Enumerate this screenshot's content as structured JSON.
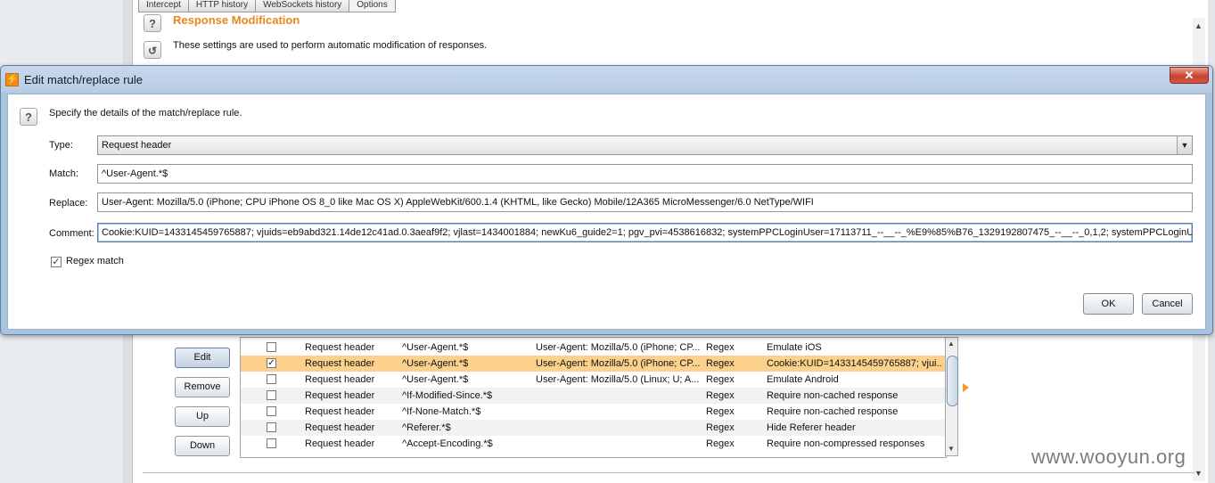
{
  "background": {
    "tabs": [
      "Intercept",
      "HTTP history",
      "WebSockets history",
      "Options"
    ],
    "active_tab": "Options",
    "section_title": "Response Modification",
    "section_desc": "These settings are used to perform automatic modification of responses.",
    "help_glyph": "?",
    "refresh_glyph": "↺"
  },
  "rules": {
    "buttons": {
      "edit": "Edit",
      "remove": "Remove",
      "up": "Up",
      "down": "Down"
    },
    "rows": [
      {
        "checked": false,
        "type": "Request header",
        "match": "^User-Agent.*$",
        "replace": "User-Agent: Mozilla/5.0 (iPhone; CP...",
        "kind": "Regex",
        "comment": "Emulate iOS"
      },
      {
        "checked": true,
        "type": "Request header",
        "match": "^User-Agent.*$",
        "replace": "User-Agent: Mozilla/5.0 (iPhone; CP...",
        "kind": "Regex",
        "comment": "Cookie:KUID=1433145459765887; vjui..."
      },
      {
        "checked": false,
        "type": "Request header",
        "match": "^User-Agent.*$",
        "replace": "User-Agent: Mozilla/5.0 (Linux; U; A...",
        "kind": "Regex",
        "comment": "Emulate Android"
      },
      {
        "checked": false,
        "type": "Request header",
        "match": "^If-Modified-Since.*$",
        "replace": "",
        "kind": "Regex",
        "comment": "Require non-cached response"
      },
      {
        "checked": false,
        "type": "Request header",
        "match": "^If-None-Match.*$",
        "replace": "",
        "kind": "Regex",
        "comment": "Require non-cached response"
      },
      {
        "checked": false,
        "type": "Request header",
        "match": "^Referer.*$",
        "replace": "",
        "kind": "Regex",
        "comment": "Hide Referer header"
      },
      {
        "checked": false,
        "type": "Request header",
        "match": "^Accept-Encoding.*$",
        "replace": "",
        "kind": "Regex",
        "comment": "Require non-compressed responses"
      }
    ]
  },
  "dialog": {
    "title": "Edit match/replace rule",
    "close_glyph": "✕",
    "logo_glyph": "⚡",
    "help_glyph": "?",
    "instruction": "Specify the details of the match/replace rule.",
    "type_label": "Type:",
    "type_value": "Request header",
    "match_label": "Match:",
    "match_value": "^User-Agent.*$",
    "replace_label": "Replace:",
    "replace_value": "User-Agent: Mozilla/5.0 (iPhone; CPU iPhone OS 8_0 like Mac OS X) AppleWebKit/600.1.4 (KHTML, like Gecko) Mobile/12A365 MicroMessenger/6.0 NetType/WIFI",
    "comment_label": "Comment:",
    "comment_value": "Cookie:KUID=1433145459765887; vjuids=eb9abd321.14de12c41ad.0.3aeaf9f2; vjlast=1434001884; newKu6_guide2=1; pgv_pvi=4538616832; systemPPCLoginUser=17113711_--__--_%E9%85%B76_1329192807475_--__--_0,1,2; systemPPCLoginUserS",
    "regex_label": "Regex match",
    "regex_checked": true,
    "ok_label": "OK",
    "cancel_label": "Cancel"
  },
  "watermark": "www.wooyun.org"
}
